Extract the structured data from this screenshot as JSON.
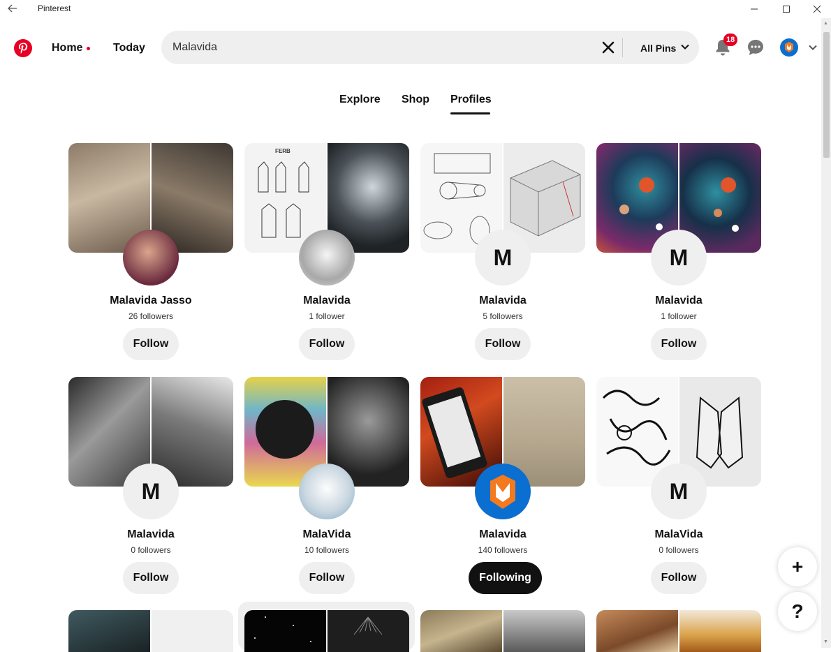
{
  "window": {
    "title": "Pinterest"
  },
  "header": {
    "home_label": "Home",
    "today_label": "Today",
    "search": {
      "value": "Malavida",
      "scope_label": "All Pins"
    },
    "notifications_count": "18"
  },
  "tabs": [
    {
      "label": "Explore",
      "active": false
    },
    {
      "label": "Shop",
      "active": false
    },
    {
      "label": "Profiles",
      "active": true
    }
  ],
  "profiles": [
    {
      "name": "Malavida Jasso",
      "followers": "26 followers",
      "button": "Follow",
      "avatar_letter": ""
    },
    {
      "name": "Malavida",
      "followers": "1 follower",
      "button": "Follow",
      "avatar_letter": ""
    },
    {
      "name": "Malavida",
      "followers": "5 followers",
      "button": "Follow",
      "avatar_letter": "M"
    },
    {
      "name": "Malavida",
      "followers": "1 follower",
      "button": "Follow",
      "avatar_letter": "M"
    },
    {
      "name": "Malavida",
      "followers": "0 followers",
      "button": "Follow",
      "avatar_letter": "M"
    },
    {
      "name": "MalaVida",
      "followers": "10 followers",
      "button": "Follow",
      "avatar_letter": ""
    },
    {
      "name": "Malavida",
      "followers": "140 followers",
      "button": "Following",
      "avatar_letter": ""
    },
    {
      "name": "MalaVida",
      "followers": "0 followers",
      "button": "Follow",
      "avatar_letter": "M"
    }
  ],
  "colors": {
    "brand": "#e60023",
    "pill_bg": "#efefef",
    "following_bg": "#111111",
    "malavida_blue": "#0a6fd0"
  },
  "floating": {
    "add_label": "+",
    "help_label": "?"
  }
}
